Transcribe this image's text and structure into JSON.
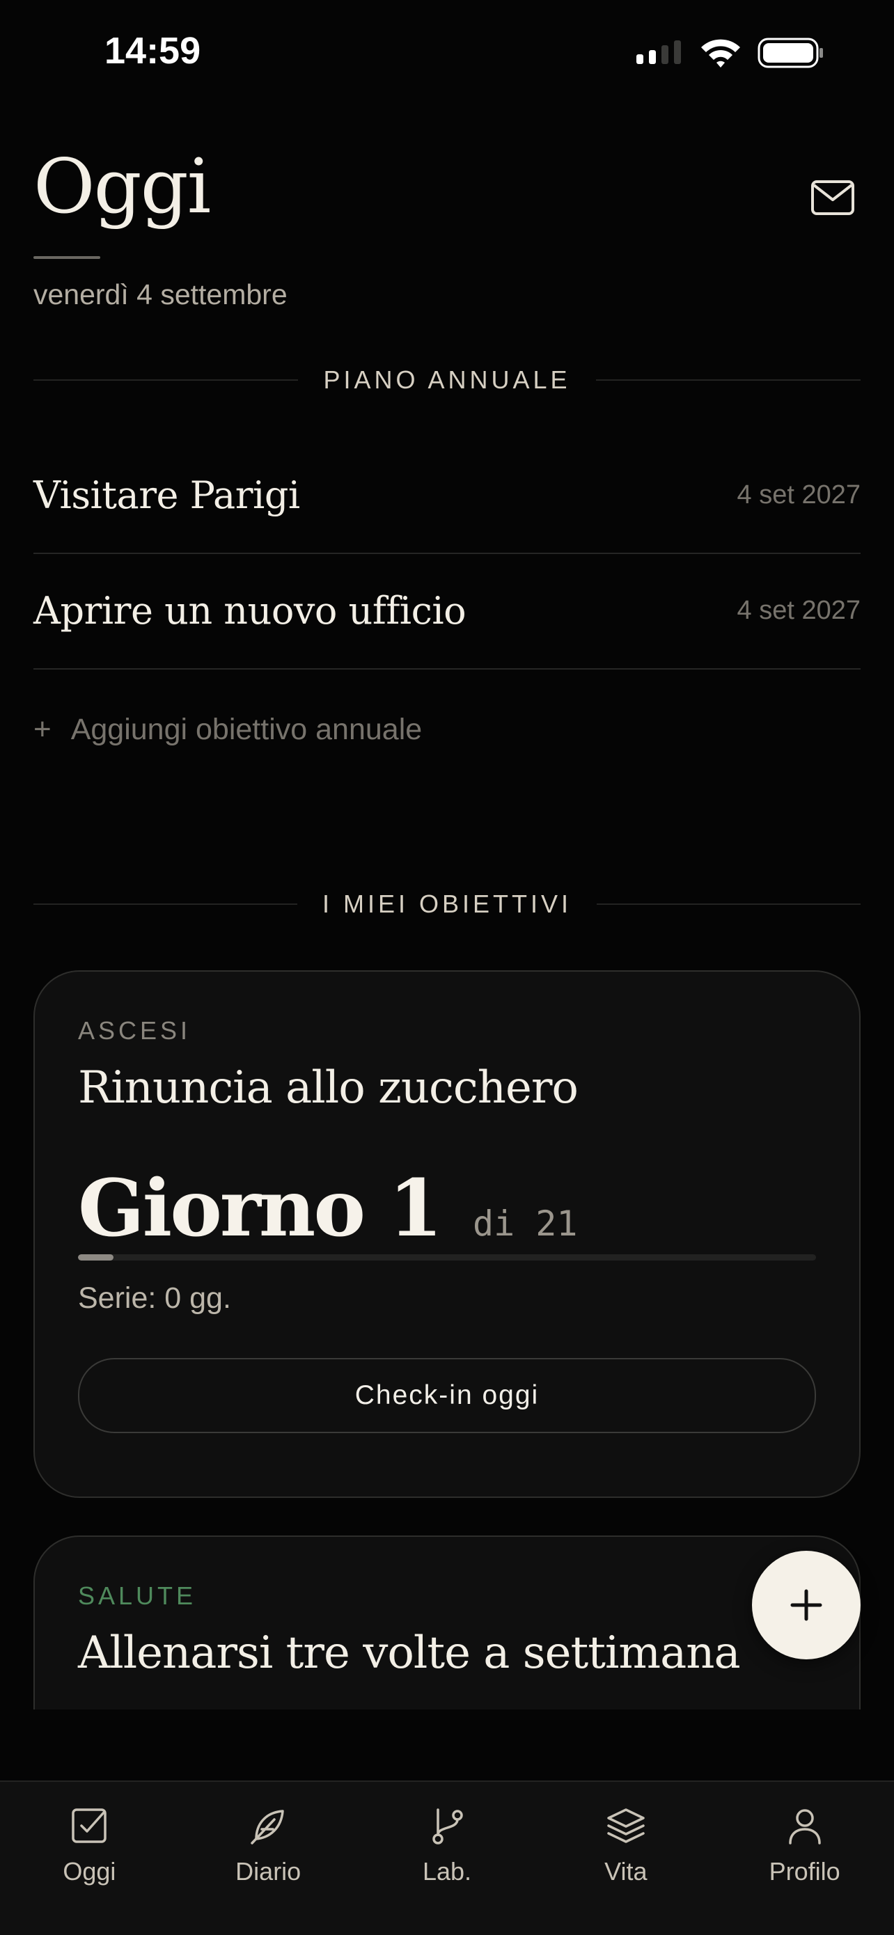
{
  "status_bar": {
    "time": "14:59"
  },
  "header": {
    "title": "Oggi",
    "date": "venerdì 4 settembre"
  },
  "annual_plan": {
    "heading": "PIANO ANNUALE",
    "items": [
      {
        "name": "Visitare Parigi",
        "date": "4 set 2027"
      },
      {
        "name": "Aprire un nuovo ufficio",
        "date": "4 set 2027"
      }
    ],
    "add_label": "Aggiungi obiettivo annuale"
  },
  "my_goals": {
    "heading": "I MIEI OBIETTIVI",
    "cards": [
      {
        "category": "ASCESI",
        "category_color": "#8a867e",
        "title": "Rinuncia allo zucchero",
        "day_label": "Giorno 1",
        "day_total": "di 21",
        "progress": 0.048,
        "streak": "Serie: 0 gg.",
        "checkin_label": "Check-in oggi"
      },
      {
        "category": "SALUTE",
        "category_color": "#4f8a5c",
        "title": "Allenarsi tre volte a settimana"
      }
    ]
  },
  "fab": {
    "icon": "plus-icon"
  },
  "tab_bar": {
    "items": [
      {
        "label": "Oggi",
        "icon": "checkbox-icon"
      },
      {
        "label": "Diario",
        "icon": "feather-icon"
      },
      {
        "label": "Lab.",
        "icon": "git-branch-icon"
      },
      {
        "label": "Vita",
        "icon": "layers-icon"
      },
      {
        "label": "Profilo",
        "icon": "user-icon"
      }
    ]
  }
}
